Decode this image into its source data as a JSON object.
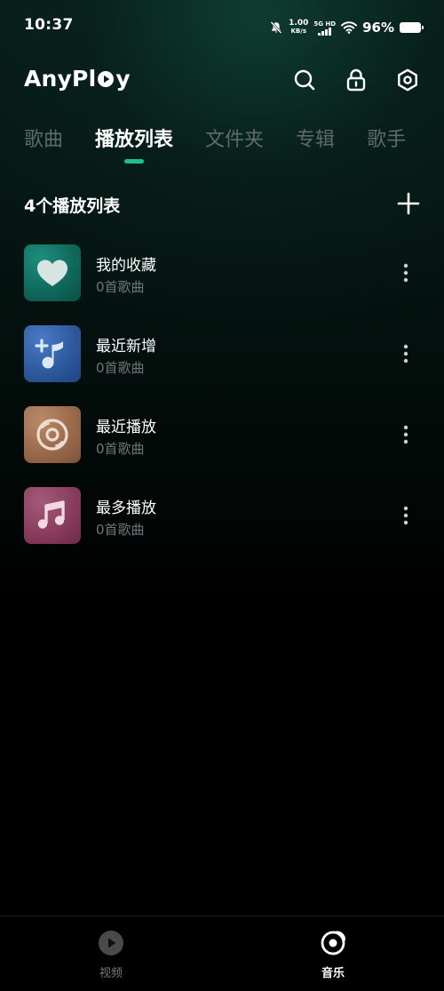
{
  "status_bar": {
    "time": "10:37",
    "speed_value": "1.00",
    "speed_unit": "KB/s",
    "network_top": "5G HD",
    "battery": "96%"
  },
  "header": {
    "logo_part1": "AnyPl",
    "logo_part2": "y",
    "accent_color": "#19c38c"
  },
  "tabs": [
    {
      "label": "歌曲",
      "active": false
    },
    {
      "label": "播放列表",
      "active": true
    },
    {
      "label": "文件夹",
      "active": false
    },
    {
      "label": "专辑",
      "active": false
    },
    {
      "label": "歌手",
      "active": false
    }
  ],
  "section": {
    "title": "4个播放列表"
  },
  "playlists": [
    {
      "title": "我的收藏",
      "subtitle": "0首歌曲",
      "icon": "heart-icon",
      "color": "#127566"
    },
    {
      "title": "最近新增",
      "subtitle": "0首歌曲",
      "icon": "music-add-icon",
      "color": "#2e5a9f"
    },
    {
      "title": "最近播放",
      "subtitle": "0首歌曲",
      "icon": "disc-icon",
      "color": "#9b6a4c"
    },
    {
      "title": "最多播放",
      "subtitle": "0首歌曲",
      "icon": "music-note-icon",
      "color": "#8a3d5c"
    }
  ],
  "bottom_nav": [
    {
      "label": "视频",
      "active": false
    },
    {
      "label": "音乐",
      "active": true
    }
  ]
}
